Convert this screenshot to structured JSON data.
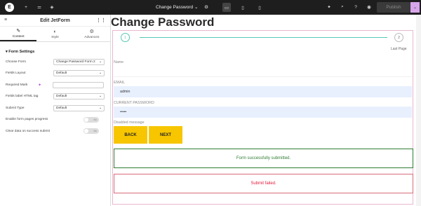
{
  "topbar": {
    "logo": "E",
    "doc_title": "Change Password",
    "publish_label": "Publish",
    "icons": [
      "elementor-logo-icon",
      "add-icon",
      "settings-sliders-icon",
      "layers-icon",
      "chevron-down-icon",
      "gear-icon",
      "desktop-icon",
      "tablet-icon",
      "mobile-icon",
      "ai-magic-icon",
      "search-icon",
      "help-icon",
      "preview-eye-icon",
      "chevron-down-icon"
    ]
  },
  "panel": {
    "title": "Edit JetForm",
    "tabs": [
      {
        "label": "Content",
        "icon": "pencil-icon",
        "active": true
      },
      {
        "label": "Style",
        "icon": "half-circle-icon",
        "active": false
      },
      {
        "label": "Advances",
        "icon": "gear-icon",
        "active": false
      }
    ],
    "section_title": "Form Settings",
    "fields": {
      "choose_form": {
        "label": "Choose Form",
        "value": "Change Password Form 2"
      },
      "fields_layout": {
        "label": "Fields Layout",
        "value": "Default"
      },
      "required_mark": {
        "label": "Required Mark",
        "value": ""
      },
      "fields_label_tag": {
        "label": "Fields label HTML tag",
        "value": "Default"
      },
      "submit_type": {
        "label": "Submit Type",
        "value": "Default"
      },
      "enable_progress": {
        "label": "Enable form pages progress",
        "toggle": "No"
      },
      "clear_data": {
        "label": "Clear data on success submit",
        "toggle": "No"
      }
    }
  },
  "canvas": {
    "page_title": "Change Password",
    "steps": [
      "1",
      "2"
    ],
    "last_page": "Last Page",
    "name_label": "Name",
    "email_label": "EMAIL",
    "email_value": "admin",
    "password_label": "CURRENT PASSWORD",
    "password_value": "•••••",
    "disabled_label": "Disabled message",
    "back_button": "BACK",
    "next_button": "NEXT",
    "success_message": "Form successfully submitted.",
    "error_message": "Submit failed."
  },
  "colors": {
    "accent_teal": "#57c7b6",
    "button_yellow": "#f7c600",
    "success_green": "#2e7d32",
    "error_red": "#e21b3a",
    "topbar_dark": "#1e1e1e"
  }
}
